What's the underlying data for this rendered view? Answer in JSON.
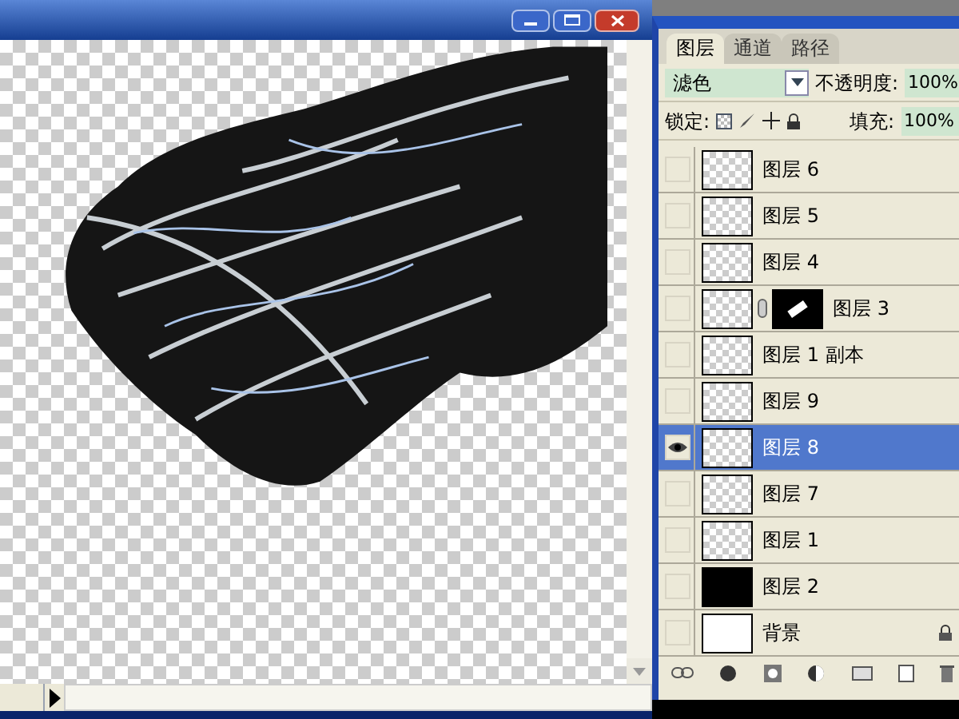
{
  "tabs": [
    {
      "label": "图层",
      "selected": true
    },
    {
      "label": "通道",
      "selected": false
    },
    {
      "label": "路径",
      "selected": false
    }
  ],
  "blend_mode": "滤色",
  "opacity_label": "不透明度:",
  "opacity": "100%",
  "lock_label": "锁定:",
  "fill_label": "填充:",
  "fill": "100%",
  "layers": [
    {
      "name": "图层 6",
      "visible": false,
      "selected": false,
      "kind": "transparent",
      "mask": false,
      "locked": false
    },
    {
      "name": "图层 5",
      "visible": false,
      "selected": false,
      "kind": "transparent",
      "mask": false,
      "locked": false
    },
    {
      "name": "图层 4",
      "visible": false,
      "selected": false,
      "kind": "transparent",
      "mask": false,
      "locked": false
    },
    {
      "name": "图层 3",
      "visible": false,
      "selected": false,
      "kind": "transparent",
      "mask": true,
      "locked": false
    },
    {
      "name": "图层 1 副本",
      "visible": false,
      "selected": false,
      "kind": "transparent",
      "mask": false,
      "locked": false
    },
    {
      "name": "图层 9",
      "visible": false,
      "selected": false,
      "kind": "transparent",
      "mask": false,
      "locked": false
    },
    {
      "name": "图层 8",
      "visible": true,
      "selected": true,
      "kind": "transparent",
      "mask": false,
      "locked": false
    },
    {
      "name": "图层 7",
      "visible": false,
      "selected": false,
      "kind": "transparent",
      "mask": false,
      "locked": false
    },
    {
      "name": "图层 1",
      "visible": false,
      "selected": false,
      "kind": "transparent",
      "mask": false,
      "locked": false
    },
    {
      "name": "图层 2",
      "visible": false,
      "selected": false,
      "kind": "black",
      "mask": false,
      "locked": false
    },
    {
      "name": "背景",
      "visible": false,
      "selected": false,
      "kind": "white",
      "mask": false,
      "locked": true
    }
  ]
}
